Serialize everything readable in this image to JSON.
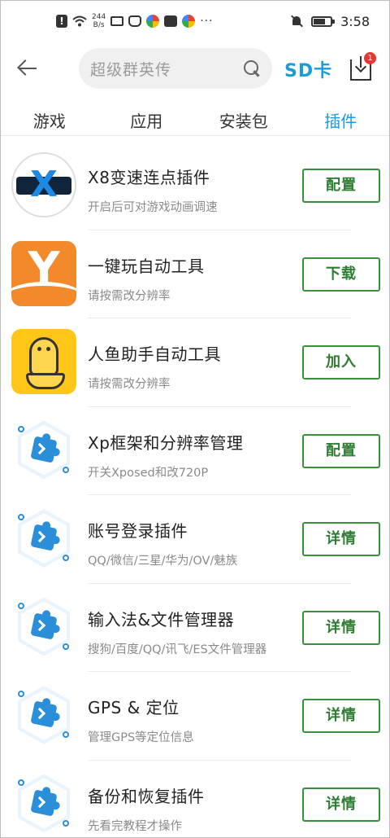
{
  "status_bar": {
    "net_speed_value": "244",
    "net_speed_unit": "B/s",
    "more": "···",
    "time": "3:58"
  },
  "header": {
    "search_placeholder": "超级群英传",
    "sd_card_label": "SD卡",
    "download_badge": "1"
  },
  "tabs": [
    {
      "label": "游戏",
      "active": false
    },
    {
      "label": "应用",
      "active": false
    },
    {
      "label": "安装包",
      "active": false
    },
    {
      "label": "插件",
      "active": true
    }
  ],
  "accent_color": "#1a9cd8",
  "button_color": "#2e7d32",
  "plugins": [
    {
      "icon": "x8-speed-icon",
      "title": "X8变速连点插件",
      "subtitle": "开启后可对游戏动画调速",
      "button": "配置"
    },
    {
      "icon": "yijian-auto-icon",
      "title": "一键玩自动工具",
      "subtitle": "请按需改分辨率",
      "button": "下载"
    },
    {
      "icon": "mermaid-helper-icon",
      "title": "人鱼助手自动工具",
      "subtitle": "请按需改分辨率",
      "button": "加入"
    },
    {
      "icon": "plugin-puzzle-icon",
      "title": "Xp框架和分辨率管理",
      "subtitle": "开关Xposed和改720P",
      "button": "配置"
    },
    {
      "icon": "plugin-puzzle-icon",
      "title": "账号登录插件",
      "subtitle": "QQ/微信/三星/华为/OV/魅族",
      "button": "详情"
    },
    {
      "icon": "plugin-puzzle-icon",
      "title": "输入法&文件管理器",
      "subtitle": "搜狗/百度/QQ/讯飞/ES文件管理器",
      "button": "详情"
    },
    {
      "icon": "plugin-puzzle-icon",
      "title": "GPS & 定位",
      "subtitle": "管理GPS等定位信息",
      "button": "详情"
    },
    {
      "icon": "plugin-puzzle-icon",
      "title": "备份和恢复插件",
      "subtitle": "先看完教程才操作",
      "button": "详情"
    }
  ]
}
